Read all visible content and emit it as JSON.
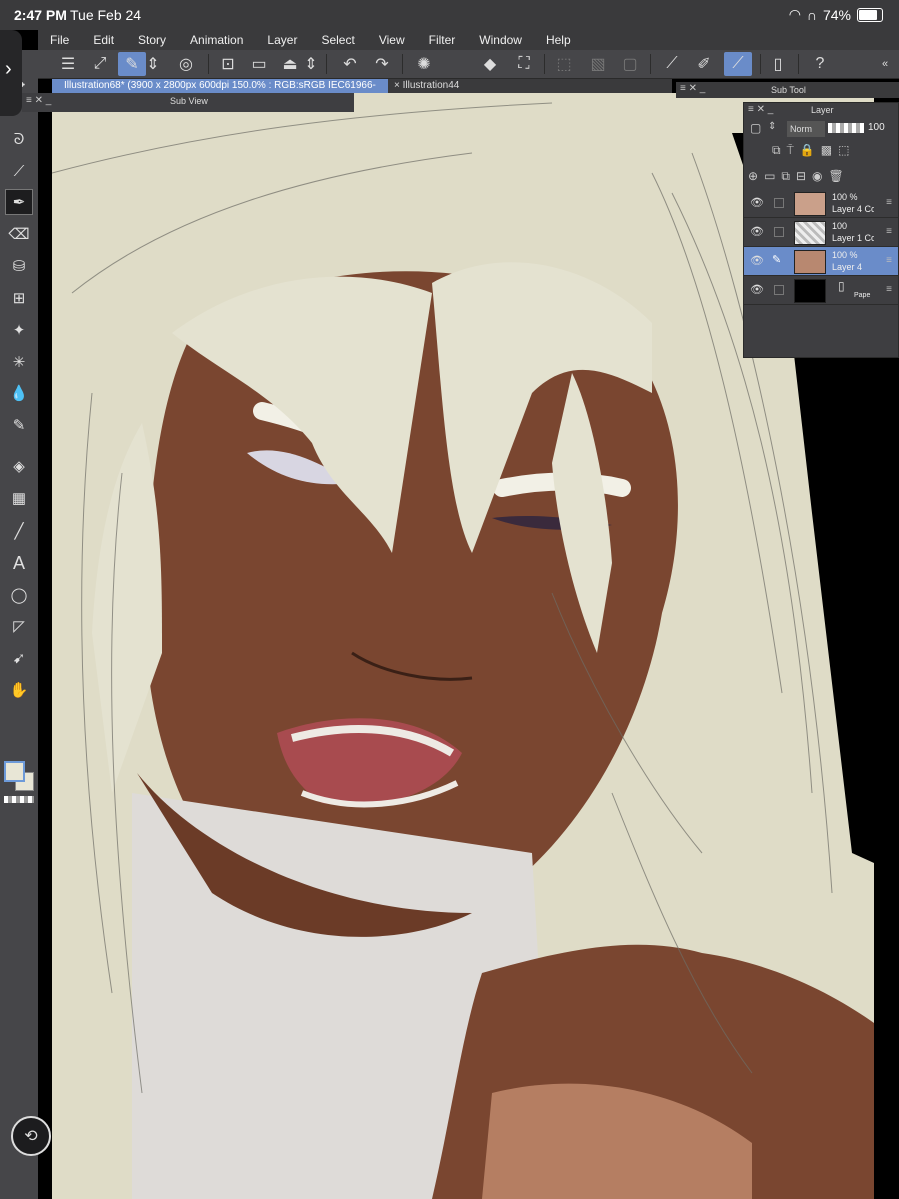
{
  "status_bar": {
    "time": "2:47 PM",
    "date": "Tue Feb 24",
    "battery": "74%"
  },
  "menu": [
    "File",
    "Edit",
    "Story",
    "Animation",
    "Layer",
    "Select",
    "View",
    "Filter",
    "Window",
    "Help"
  ],
  "tabs": {
    "active": "Illustration68* (3900 x 2800px 600dpi 150.0% : RGB:sRGB IEC61966-2.1)",
    "inactive": "Illustration44",
    "close_glyph": "×"
  },
  "panels": {
    "sub_view": "Sub View",
    "sub_tool": "Sub Tool",
    "layer": "Layer"
  },
  "layer_panel": {
    "blend_mode": "Norm",
    "opacity": "100",
    "layers": [
      {
        "opacity": "100 %",
        "name": "Layer 4 Co",
        "mode": "N",
        "selected": false,
        "thumb": "#caa08a"
      },
      {
        "opacity": "100",
        "name": "Layer 1 Co",
        "mode": "",
        "selected": false,
        "thumb": "#d8d8d8"
      },
      {
        "opacity": "100 %",
        "name": "Layer 4",
        "mode": "N",
        "selected": true,
        "thumb": "#b88870"
      },
      {
        "opacity": "",
        "name": "Pape",
        "mode": "",
        "selected": false,
        "thumb": "#000000"
      }
    ]
  },
  "colors": {
    "accent": "#6a8cc9",
    "hair": "#e5e3d1",
    "skin": "#7a4630",
    "lips": "#a84b4f"
  }
}
